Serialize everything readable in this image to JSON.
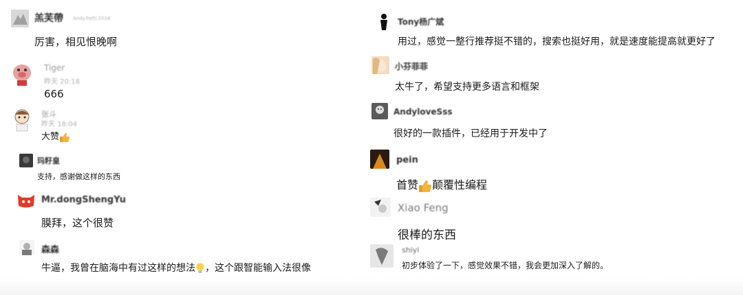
{
  "left_comments": [
    {
      "name": "羔芙帶",
      "name_suffix": "Andy.Fetti.2016",
      "time": "",
      "text": "厉害，相见恨晚啊"
    },
    {
      "name": "Tiger",
      "name_suffix": "",
      "time": "昨天 20:18",
      "text": "666"
    },
    {
      "name": "张斗",
      "name_suffix": "",
      "time": "昨天 18:04",
      "text": "大赞",
      "emoji": "thumbs-up"
    },
    {
      "name": "玛籽皇",
      "name_suffix": "",
      "time": "",
      "text": "支持，感谢做这样的东西"
    },
    {
      "name": "Mr.dongShengYu",
      "name_suffix": "",
      "time": "",
      "text": "膜拜，这个很赞"
    },
    {
      "name": "森森",
      "name_suffix": "",
      "time": "",
      "text": "牛逼，我曾在脑海中有过这样的想法",
      "emoji": "lightbulb",
      "text_after": "，这个跟智能输入法很像"
    }
  ],
  "right_comments": [
    {
      "name": "Tony杨广斌",
      "text": "用过，感觉一整行推荐挺不错的，搜索也挺好用，就是速度能提高就更好了"
    },
    {
      "name": "小芬菲菲",
      "text": "太牛了，希望支持更多语言和框架"
    },
    {
      "name": "AndyloveSss",
      "text": "很好的一款插件，已经用于开发中了"
    },
    {
      "name": "pein",
      "text_before": "首赞",
      "emoji": "thumbs-up",
      "text": "颠覆性编程"
    },
    {
      "name": "Xiao Feng",
      "text": "很棒的东西"
    },
    {
      "name": "shiyi",
      "text": "初步体验了一下，感觉效果不错，我会更加深入了解的。"
    }
  ],
  "colors": {
    "text": "#1a1a1a",
    "name": "#333333",
    "meta": "#b0b0b0",
    "thumb": "#f2b43c",
    "bulb": "#f5d24a"
  }
}
